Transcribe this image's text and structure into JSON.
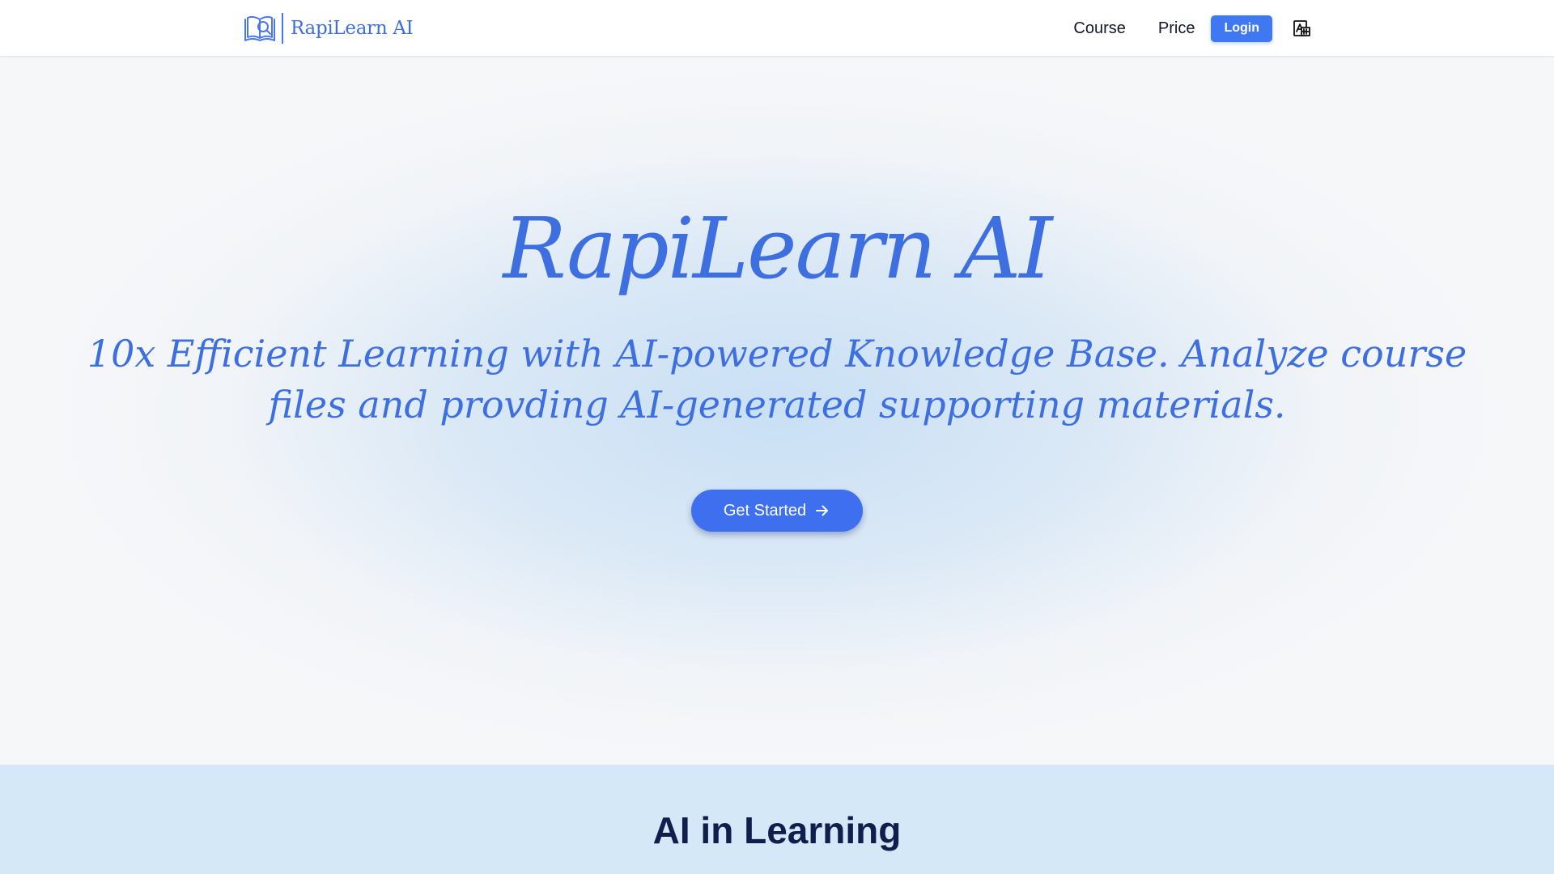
{
  "header": {
    "brand_name": "RapiLearn AI",
    "brand_icon": "book-search-icon",
    "nav": {
      "course": "Course",
      "price": "Price",
      "login": "Login"
    },
    "language_icon": "translate-icon"
  },
  "hero": {
    "title": "RapiLearn AI",
    "subtitle": "10x Efficient Learning with AI-powered Knowledge Base. Analyze course files and provding AI-generated supporting materials.",
    "cta_label": "Get Started",
    "cta_icon": "arrow-right-icon"
  },
  "section": {
    "title": "AI in Learning"
  },
  "colors": {
    "brand": "#3d6fe0",
    "button": "#3e78f2",
    "section_bg": "#d4e8f7",
    "section_title": "#0f1f4d"
  }
}
